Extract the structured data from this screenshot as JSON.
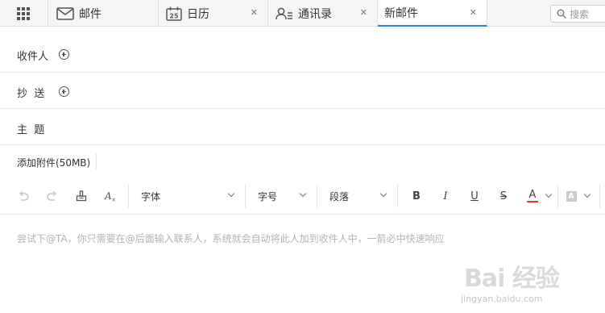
{
  "tabs": {
    "mail": {
      "label": "邮件",
      "icon": "envelope-icon"
    },
    "calendar": {
      "label": "日历",
      "icon": "calendar-icon",
      "day": "25",
      "close": "✕"
    },
    "contacts": {
      "label": "通讯录",
      "icon": "contacts-icon",
      "close": "✕"
    },
    "compose": {
      "label": "新邮件",
      "close": "✕"
    }
  },
  "search": {
    "placeholder": "搜索",
    "icon": "search-icon"
  },
  "form": {
    "to_label": "收件人",
    "cc_label": "抄  送",
    "subject_label": "主  题",
    "attachment_label": "添加附件(50MB)"
  },
  "toolbar": {
    "font_label": "字体",
    "size_label": "字号",
    "paragraph_label": "段落",
    "bold": "B",
    "italic": "I",
    "underline": "U",
    "strike": "S",
    "font_color_letter": "A",
    "highlight_letter": "A",
    "font_color": "#e53935"
  },
  "editor": {
    "placeholder": "尝试下@TA，你只需要在@后面输入联系人，系统就会自动将此人加到收件人中，一箭必中快速响应"
  },
  "watermark": {
    "logo": "Bai 经验",
    "url": "jingyan.baidu.com"
  },
  "colors": {
    "accent": "#1f84d6",
    "tabbar_bg": "#f4f5f7",
    "border": "#e6e8eb"
  }
}
